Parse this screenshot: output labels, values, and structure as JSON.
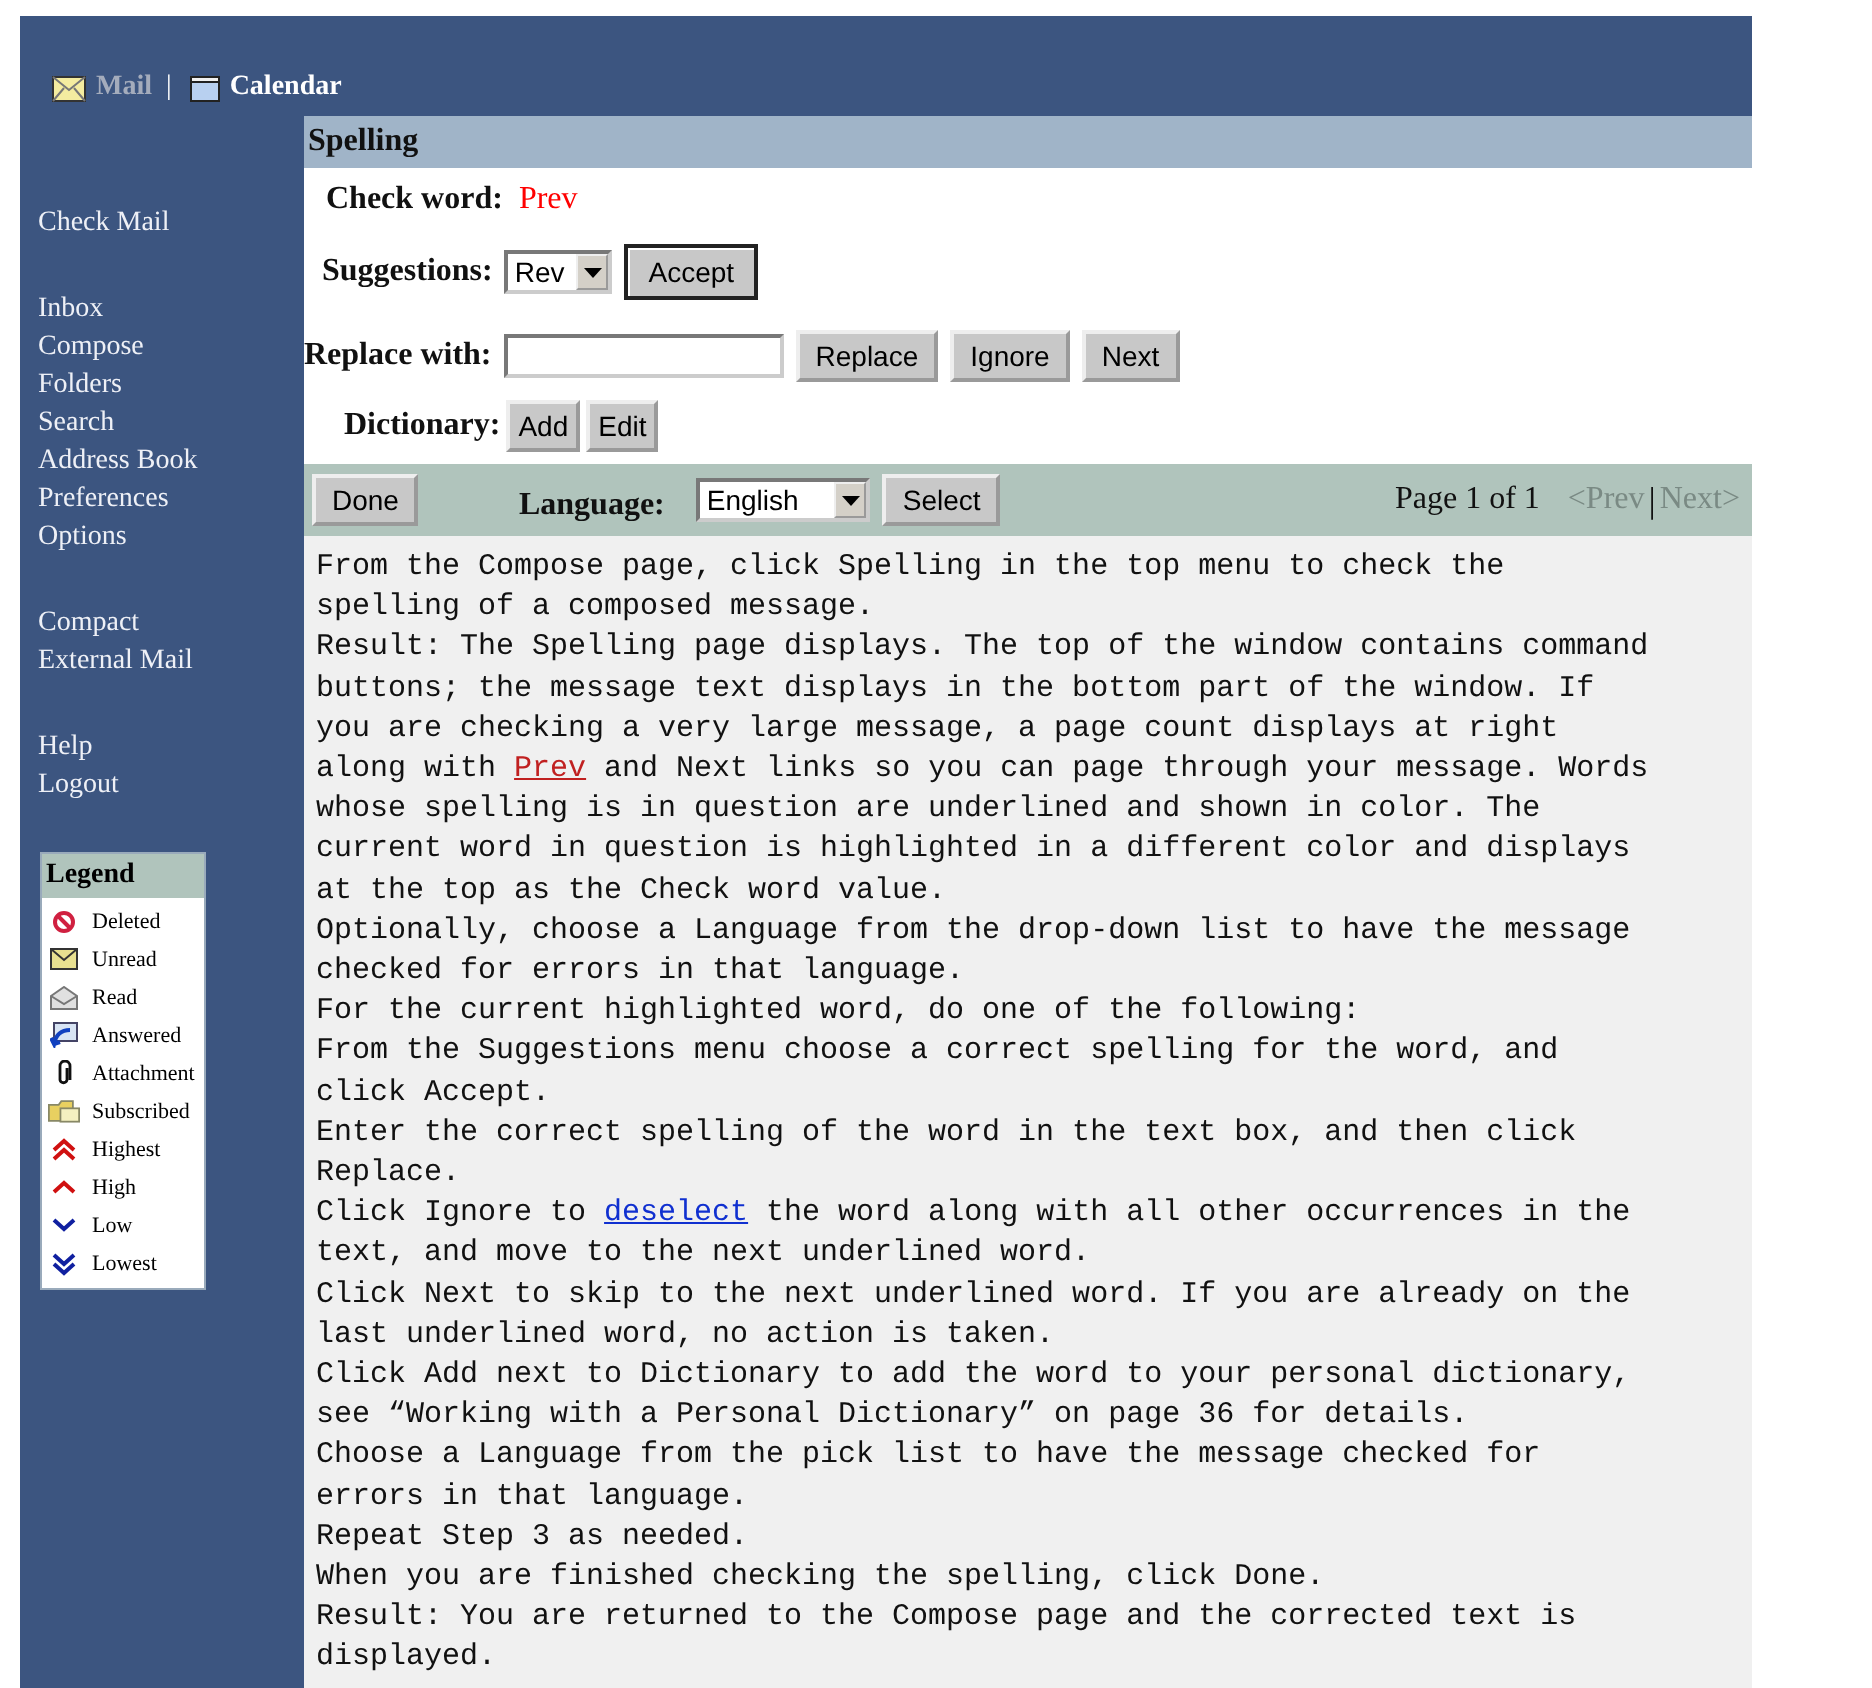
{
  "top_nav": [
    {
      "label": "Mail",
      "kind": "mail",
      "selected": true
    },
    {
      "label": "Calendar",
      "kind": "calendar",
      "selected": false
    }
  ],
  "top_nav_separator": "|",
  "sidebar": {
    "groups": [
      [
        "Check Mail"
      ],
      [
        "Inbox",
        "Compose",
        "Folders",
        "Search",
        "Address Book",
        "Preferences",
        "Options"
      ],
      [
        "Compact",
        "External Mail"
      ],
      [
        "Help",
        "Logout"
      ]
    ]
  },
  "legend": {
    "title": "Legend",
    "items": [
      {
        "label": "Deleted",
        "kind": "deleted"
      },
      {
        "label": "Unread",
        "kind": "unread"
      },
      {
        "label": "Read",
        "kind": "read"
      },
      {
        "label": "Answered",
        "kind": "answered"
      },
      {
        "label": "Attachment",
        "kind": "attachment"
      },
      {
        "label": "Subscribed",
        "kind": "subscribed"
      },
      {
        "label": "Highest",
        "kind": "highest"
      },
      {
        "label": "High",
        "kind": "high"
      },
      {
        "label": "Low",
        "kind": "low"
      },
      {
        "label": "Lowest",
        "kind": "lowest"
      }
    ]
  },
  "panel_title": "Spelling",
  "check_word": {
    "label": "Check word:",
    "value": "Prev"
  },
  "suggestions": {
    "label": "Suggestions:",
    "value": "Rev",
    "button": "Accept"
  },
  "replace_with": {
    "label": "Replace with:",
    "buttons": [
      "Replace",
      "Ignore",
      "Next"
    ]
  },
  "dictionary": {
    "label": "Dictionary:",
    "buttons": [
      "Add",
      "Edit"
    ]
  },
  "toolbar": {
    "done": "Done",
    "language_label": "Language:",
    "language": "English",
    "select": "Select",
    "page_count": "Page 1 of 1",
    "prev": {
      "label": "<Prev",
      "disabled": true
    },
    "separator": "|",
    "next": {
      "label": "Next>",
      "disabled": true
    }
  },
  "message_lines": [
    [
      {
        "text": "From the Compose page, click Spelling in the top menu to check the"
      }
    ],
    [
      {
        "text": "spelling of a composed message."
      }
    ],
    [
      {
        "text": "Result: The Spelling page displays. The top of the window contains command"
      }
    ],
    [
      {
        "text": "buttons; the message text displays in the bottom part of the window. If"
      }
    ],
    [
      {
        "text": "you are checking a very large message, a page count displays at right"
      }
    ],
    [
      {
        "text": "along with "
      },
      {
        "text": "Prev",
        "kind": "current"
      },
      {
        "text": " and Next links so you can page through your message. Words"
      }
    ],
    [
      {
        "text": "whose spelling is in question are underlined and shown in color. The"
      }
    ],
    [
      {
        "text": "current word in question is highlighted in a different color and displays"
      }
    ],
    [
      {
        "text": "at the top as the Check word value."
      }
    ],
    [
      {
        "text": "Optionally, choose a Language from the drop-down list to have the message"
      }
    ],
    [
      {
        "text": "checked for errors in that language."
      }
    ],
    [
      {
        "text": "For the current highlighted word, do one of the following:"
      }
    ],
    [
      {
        "text": "From the Suggestions menu choose a correct spelling for the word, and"
      }
    ],
    [
      {
        "text": "click Accept."
      }
    ],
    [
      {
        "text": "Enter the correct spelling of the word in the text box, and then click"
      }
    ],
    [
      {
        "text": "Replace."
      }
    ],
    [
      {
        "text": "Click Ignore to "
      },
      {
        "text": "deselect",
        "kind": "misspelled"
      },
      {
        "text": " the word along with all other occurrences in the"
      }
    ],
    [
      {
        "text": "text, and move to the next underlined word."
      }
    ],
    [
      {
        "text": "Click Next to skip to the next underlined word. If you are already on the"
      }
    ],
    [
      {
        "text": "last underlined word, no action is taken."
      }
    ],
    [
      {
        "text": "Click Add next to Dictionary to add the word to your personal dictionary,"
      }
    ],
    [
      {
        "text": "see “Working with a Personal Dictionary” on page 36 for details."
      }
    ],
    [
      {
        "text": "Choose a Language from the pick list to have the message checked for"
      }
    ],
    [
      {
        "text": "errors in that language."
      }
    ],
    [
      {
        "text": "Repeat Step 3 as needed."
      }
    ],
    [
      {
        "text": "When you are finished checking the spelling, click Done."
      }
    ],
    [
      {
        "text": "Result: You are returned to the Compose page and the corrected text is"
      }
    ],
    [
      {
        "text": "displayed."
      }
    ]
  ]
}
